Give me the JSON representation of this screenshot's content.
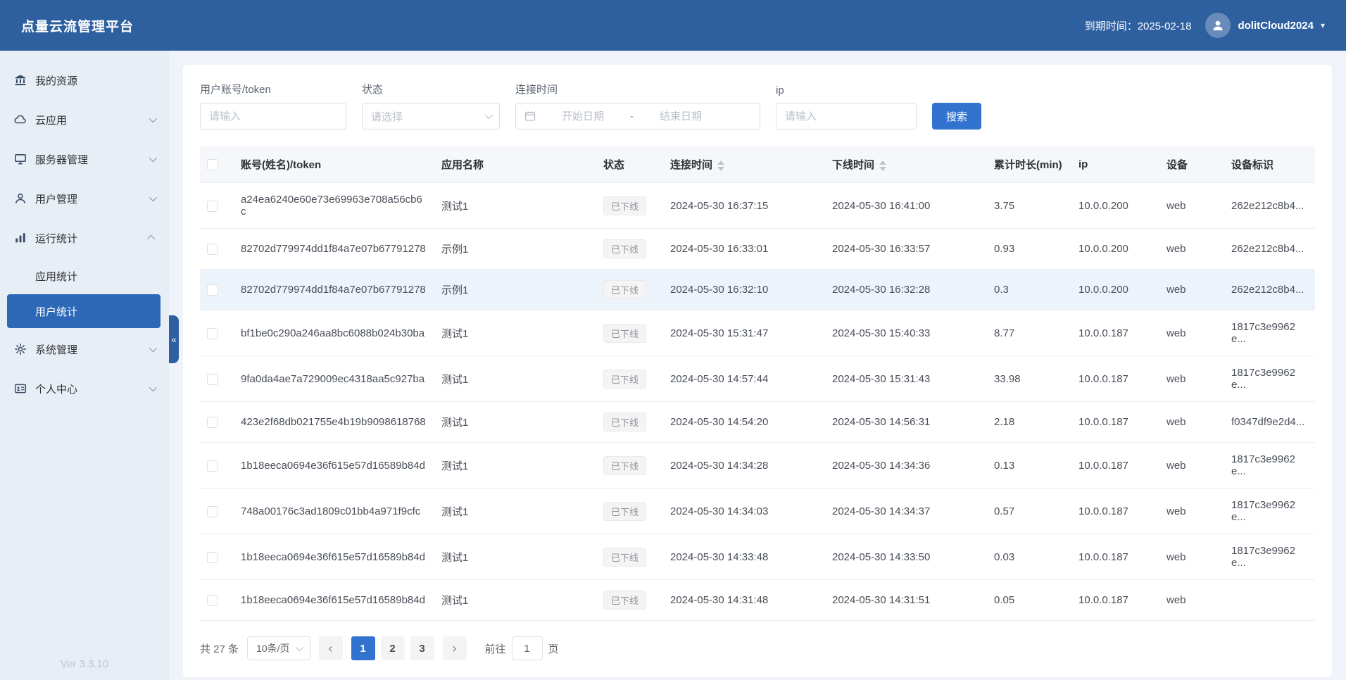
{
  "header": {
    "app_title": "点量云流管理平台",
    "expire_text": "到期时间：2025-02-18",
    "username": "dolitCloud2024",
    "user_caret": "▾"
  },
  "sidebar": {
    "items": [
      {
        "label": "我的资源",
        "icon": "bank-icon"
      },
      {
        "label": "云应用",
        "icon": "cloud-icon"
      },
      {
        "label": "服务器管理",
        "icon": "monitor-icon"
      },
      {
        "label": "用户管理",
        "icon": "user-icon"
      },
      {
        "label": "运行统计",
        "icon": "chart-icon",
        "expanded": true,
        "children": [
          "应用统计",
          "用户统计"
        ],
        "active_child": "用户统计"
      },
      {
        "label": "系统管理",
        "icon": "gear-icon"
      },
      {
        "label": "个人中心",
        "icon": "id-card-icon"
      }
    ],
    "collapse_glyph": "«",
    "version": "Ver 3.3.10"
  },
  "filters": {
    "account_label": "用户账号/token",
    "account_placeholder": "请输入",
    "status_label": "状态",
    "status_placeholder": "请选择",
    "time_label": "连接时间",
    "start_placeholder": "开始日期",
    "range_separator": "-",
    "end_placeholder": "结束日期",
    "ip_label": "ip",
    "ip_placeholder": "请输入",
    "search_button": "搜索"
  },
  "table": {
    "columns": [
      "账号(姓名)/token",
      "应用名称",
      "状态",
      "连接时间",
      "下线时间",
      "累计时长(min)",
      "ip",
      "设备",
      "设备标识"
    ],
    "rows": [
      {
        "token": "a24ea6240e60e73e69963e708a56cb6c",
        "app": "测试1",
        "status": "已下线",
        "connect_time": "2024-05-30 16:37:15",
        "offline_time": "2024-05-30 16:41:00",
        "duration": "3.75",
        "ip": "10.0.0.200",
        "device": "web",
        "device_id": "262e212c8b4..."
      },
      {
        "token": "82702d779974dd1f84a7e07b67791278",
        "app": "示例1",
        "status": "已下线",
        "connect_time": "2024-05-30 16:33:01",
        "offline_time": "2024-05-30 16:33:57",
        "duration": "0.93",
        "ip": "10.0.0.200",
        "device": "web",
        "device_id": "262e212c8b4..."
      },
      {
        "token": "82702d779974dd1f84a7e07b67791278",
        "app": "示例1",
        "status": "已下线",
        "connect_time": "2024-05-30 16:32:10",
        "offline_time": "2024-05-30 16:32:28",
        "duration": "0.3",
        "ip": "10.0.0.200",
        "device": "web",
        "device_id": "262e212c8b4...",
        "highlighted": true
      },
      {
        "token": "bf1be0c290a246aa8bc6088b024b30ba",
        "app": "测试1",
        "status": "已下线",
        "connect_time": "2024-05-30 15:31:47",
        "offline_time": "2024-05-30 15:40:33",
        "duration": "8.77",
        "ip": "10.0.0.187",
        "device": "web",
        "device_id": "1817c3e9962e..."
      },
      {
        "token": "9fa0da4ae7a729009ec4318aa5c927ba",
        "app": "测试1",
        "status": "已下线",
        "connect_time": "2024-05-30 14:57:44",
        "offline_time": "2024-05-30 15:31:43",
        "duration": "33.98",
        "ip": "10.0.0.187",
        "device": "web",
        "device_id": "1817c3e9962e..."
      },
      {
        "token": "423e2f68db021755e4b19b9098618768",
        "app": "测试1",
        "status": "已下线",
        "connect_time": "2024-05-30 14:54:20",
        "offline_time": "2024-05-30 14:56:31",
        "duration": "2.18",
        "ip": "10.0.0.187",
        "device": "web",
        "device_id": "f0347df9e2d4..."
      },
      {
        "token": "1b18eeca0694e36f615e57d16589b84d",
        "app": "测试1",
        "status": "已下线",
        "connect_time": "2024-05-30 14:34:28",
        "offline_time": "2024-05-30 14:34:36",
        "duration": "0.13",
        "ip": "10.0.0.187",
        "device": "web",
        "device_id": "1817c3e9962e..."
      },
      {
        "token": "748a00176c3ad1809c01bb4a971f9cfc",
        "app": "测试1",
        "status": "已下线",
        "connect_time": "2024-05-30 14:34:03",
        "offline_time": "2024-05-30 14:34:37",
        "duration": "0.57",
        "ip": "10.0.0.187",
        "device": "web",
        "device_id": "1817c3e9962e..."
      },
      {
        "token": "1b18eeca0694e36f615e57d16589b84d",
        "app": "测试1",
        "status": "已下线",
        "connect_time": "2024-05-30 14:33:48",
        "offline_time": "2024-05-30 14:33:50",
        "duration": "0.03",
        "ip": "10.0.0.187",
        "device": "web",
        "device_id": "1817c3e9962e..."
      },
      {
        "token": "1b18eeca0694e36f615e57d16589b84d",
        "app": "测试1",
        "status": "已下线",
        "connect_time": "2024-05-30 14:31:48",
        "offline_time": "2024-05-30 14:31:51",
        "duration": "0.05",
        "ip": "10.0.0.187",
        "device": "web",
        "device_id": ""
      }
    ]
  },
  "pagination": {
    "total_text": "共 27 条",
    "page_size": "10条/页",
    "prev_icon": "‹",
    "next_icon": "›",
    "pages": [
      "1",
      "2",
      "3"
    ],
    "active_page": "1",
    "goto_label": "前往",
    "goto_value": "1",
    "goto_unit": "页"
  },
  "colors": {
    "topbar_bg": "#2e5f9f",
    "sidebar_bg": "#e8eef6",
    "sidebar_active_bg": "#2d68b7",
    "primary_button": "#3273cf",
    "status_offline_text": "#909399",
    "status_offline_bg": "#f4f4f5"
  }
}
